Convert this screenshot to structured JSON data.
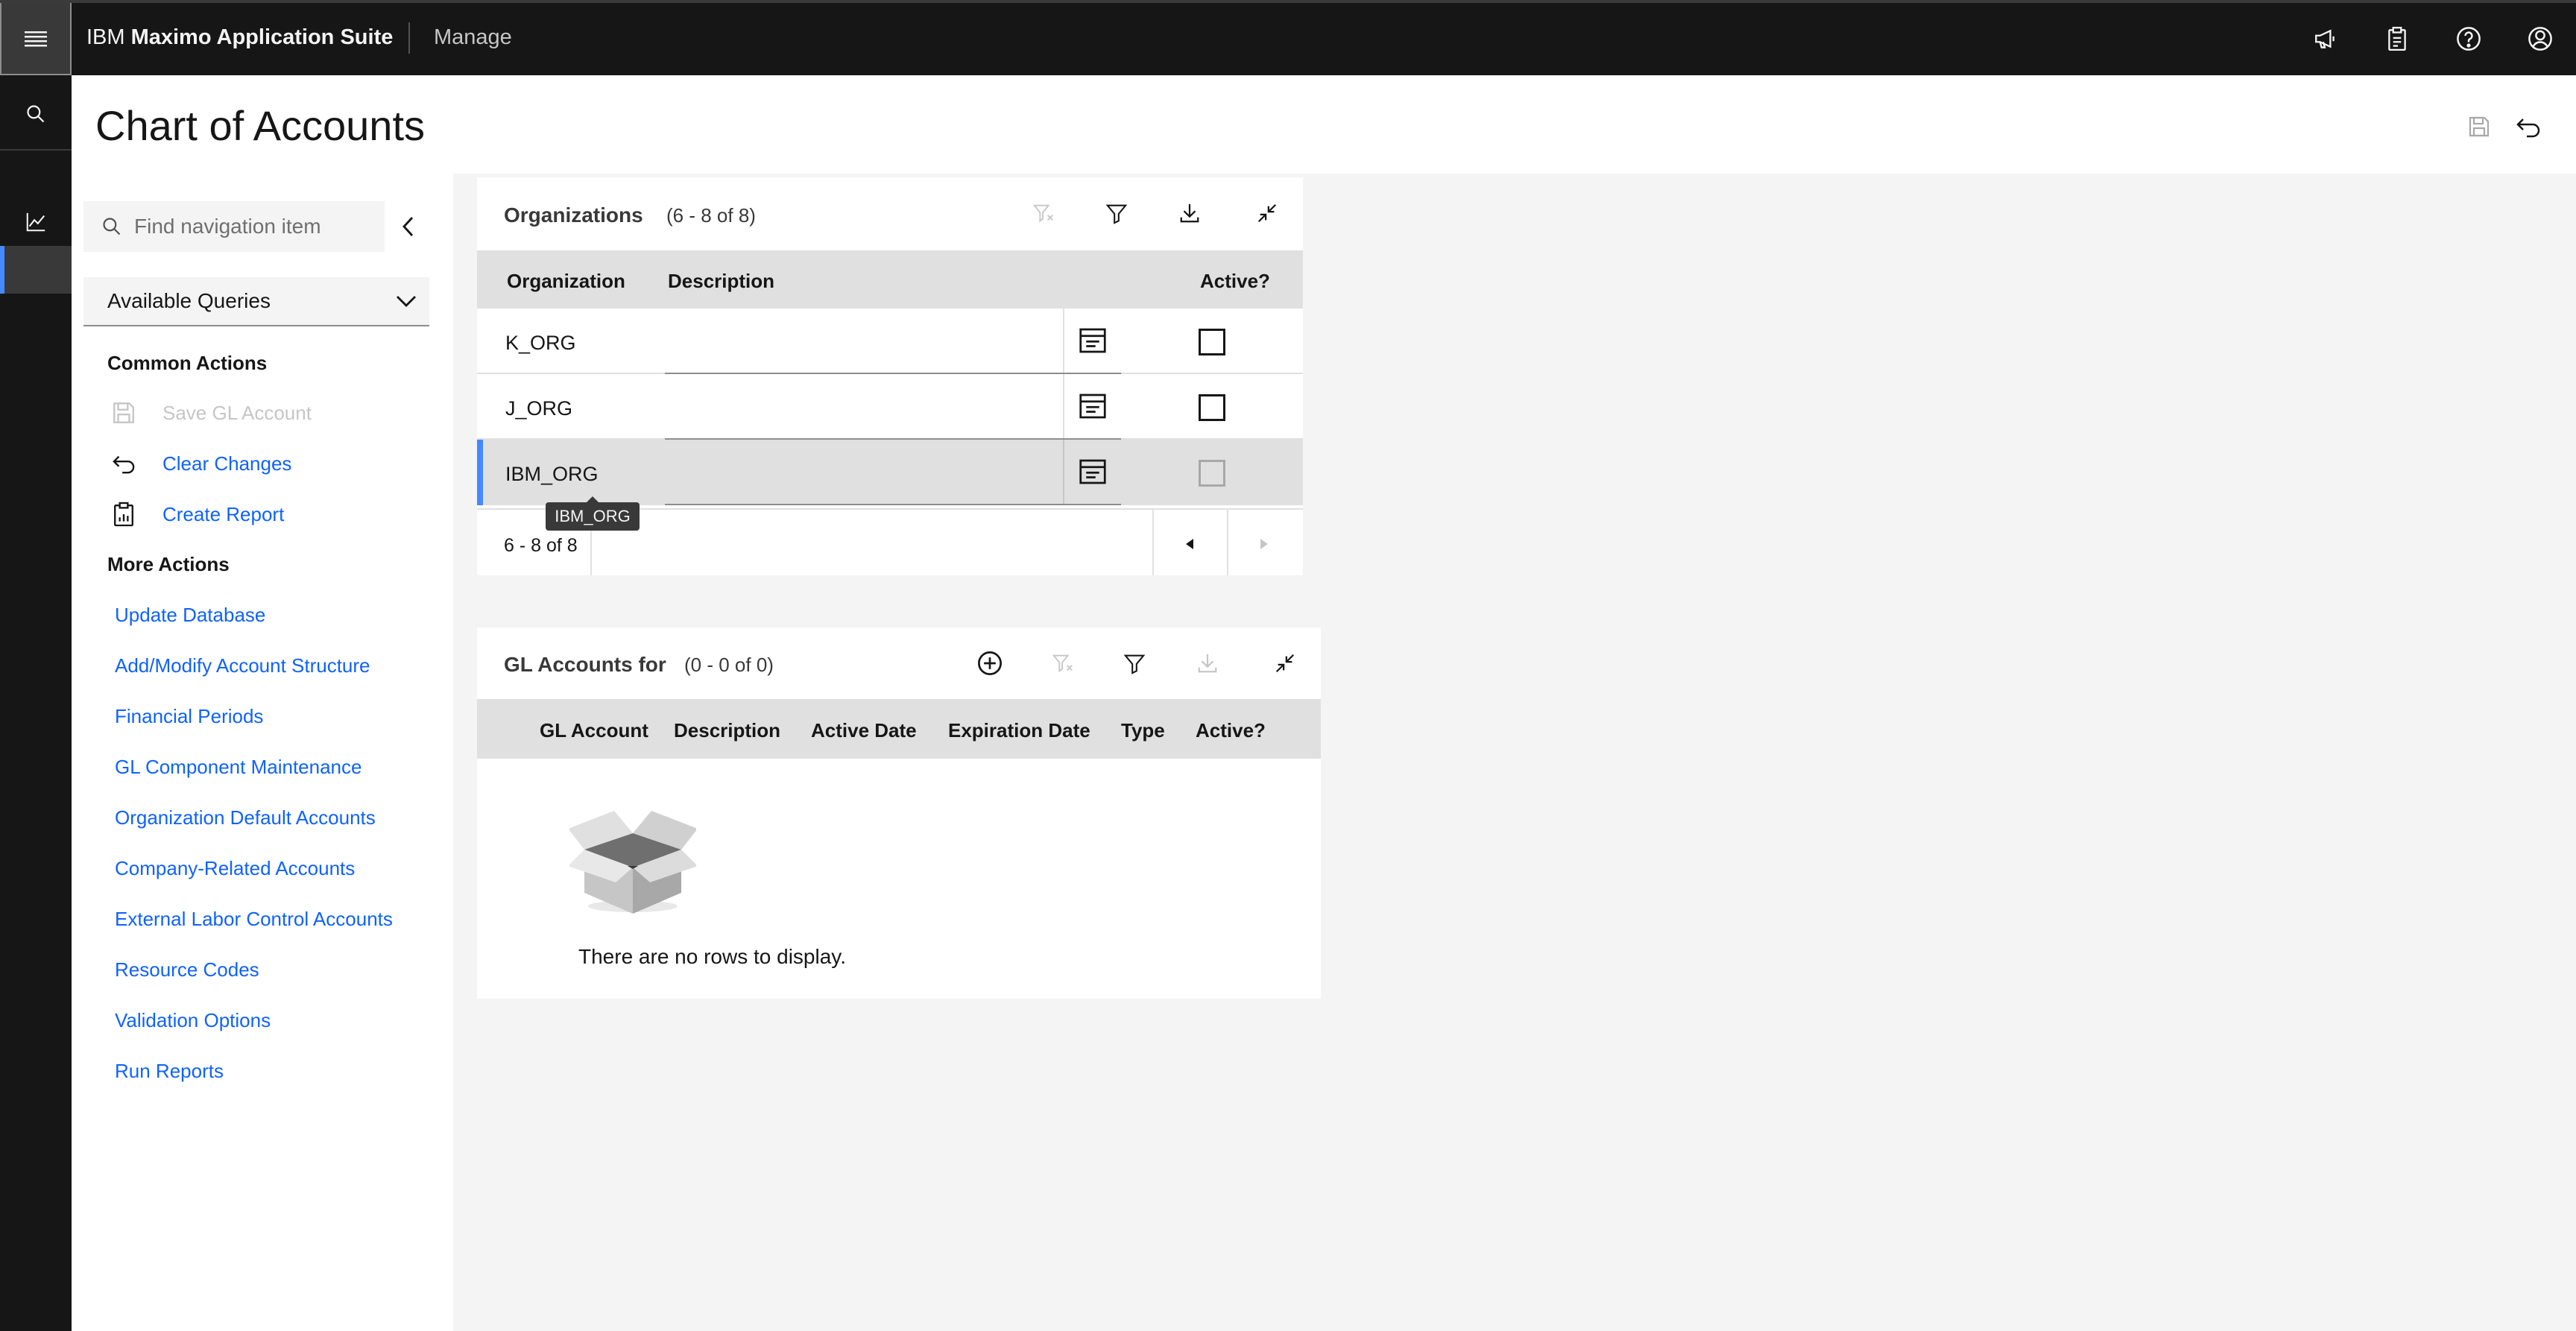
{
  "topbar": {
    "brand_prefix": "IBM",
    "brand_name": "Maximo Application Suite",
    "app_name": "Manage",
    "icons": [
      "menu-icon",
      "announcement-icon",
      "clipboard-icon",
      "help-icon",
      "user-avatar-icon"
    ]
  },
  "rail": {
    "icons": [
      "search-icon",
      "chart-line-icon"
    ]
  },
  "header": {
    "title": "Chart of Accounts"
  },
  "nav": {
    "search_placeholder": "Find navigation item",
    "queries_label": "Available Queries",
    "common_actions_title": "Common Actions",
    "common_actions": [
      {
        "label": "Save GL Account",
        "icon": "save-icon",
        "enabled": false
      },
      {
        "label": "Clear Changes",
        "icon": "undo-icon",
        "enabled": true
      },
      {
        "label": "Create Report",
        "icon": "report-icon",
        "enabled": true
      }
    ],
    "more_actions_title": "More Actions",
    "more_actions": [
      "Update Database",
      "Add/Modify Account Structure",
      "Financial Periods",
      "GL Component Maintenance",
      "Organization Default Accounts",
      "Company-Related Accounts",
      "External Labor Control Accounts",
      "Resource Codes",
      "Validation Options",
      "Run Reports"
    ]
  },
  "organizations": {
    "title": "Organizations",
    "count": "(6 - 8 of 8)",
    "columns": [
      "Organization",
      "Description",
      "Active?"
    ],
    "rows": [
      {
        "organization": "K_ORG",
        "description": "",
        "active": false
      },
      {
        "organization": "J_ORG",
        "description": "",
        "active": false
      },
      {
        "organization": "IBM_ORG",
        "description": "",
        "active": false,
        "selected": true
      }
    ],
    "pagination": "6 - 8 of 8",
    "tooltip": "IBM_ORG"
  },
  "gl_accounts": {
    "title": "GL Accounts for",
    "count": "(0 - 0 of 0)",
    "columns": [
      "GL Account",
      "Description",
      "Active Date",
      "Expiration Date",
      "Type",
      "Active?"
    ],
    "empty_message": "There are no rows to display."
  },
  "colors": {
    "topbar_bg": "#161616",
    "accent": "#0f62fe",
    "selection_bar": "#4589ff",
    "table_header": "#e0e0e0"
  }
}
